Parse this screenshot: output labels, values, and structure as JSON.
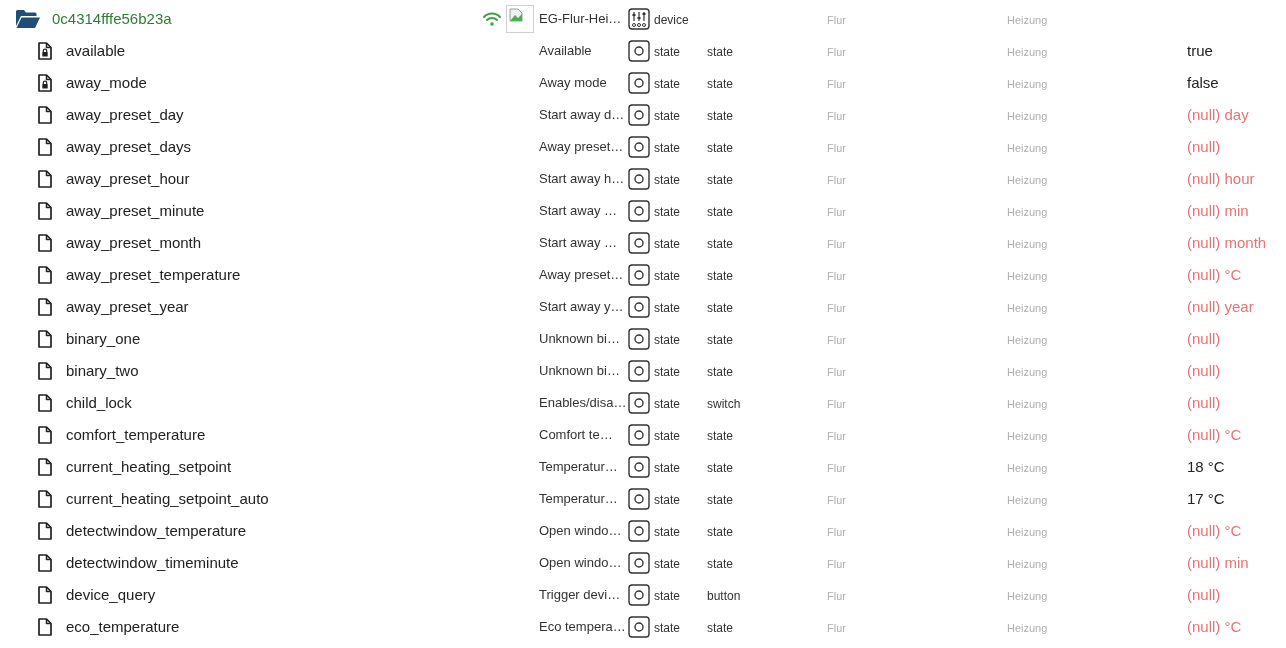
{
  "device": {
    "id": "0c4314fffe56b23a",
    "expanded": true,
    "online": true,
    "name": "EG-Flur-Hei…",
    "type": "device",
    "room": "Flur",
    "function": "Heizung"
  },
  "states": [
    {
      "id": "available",
      "locked": true,
      "name": "Available",
      "type": "state",
      "role": "state",
      "room": "Flur",
      "function": "Heizung",
      "value": "true",
      "is_null": false
    },
    {
      "id": "away_mode",
      "locked": true,
      "name": "Away mode",
      "type": "state",
      "role": "state",
      "room": "Flur",
      "function": "Heizung",
      "value": "false",
      "is_null": false
    },
    {
      "id": "away_preset_day",
      "locked": false,
      "name": "Start away d…",
      "type": "state",
      "role": "state",
      "room": "Flur",
      "function": "Heizung",
      "value": "(null) day",
      "is_null": true
    },
    {
      "id": "away_preset_days",
      "locked": false,
      "name": "Away preset…",
      "type": "state",
      "role": "state",
      "room": "Flur",
      "function": "Heizung",
      "value": "(null)",
      "is_null": true
    },
    {
      "id": "away_preset_hour",
      "locked": false,
      "name": "Start away h…",
      "type": "state",
      "role": "state",
      "room": "Flur",
      "function": "Heizung",
      "value": "(null) hour",
      "is_null": true
    },
    {
      "id": "away_preset_minute",
      "locked": false,
      "name": "Start away …",
      "type": "state",
      "role": "state",
      "room": "Flur",
      "function": "Heizung",
      "value": "(null) min",
      "is_null": true
    },
    {
      "id": "away_preset_month",
      "locked": false,
      "name": "Start away …",
      "type": "state",
      "role": "state",
      "room": "Flur",
      "function": "Heizung",
      "value": "(null) month",
      "is_null": true
    },
    {
      "id": "away_preset_temperature",
      "locked": false,
      "name": "Away preset…",
      "type": "state",
      "role": "state",
      "room": "Flur",
      "function": "Heizung",
      "value": "(null) °C",
      "is_null": true
    },
    {
      "id": "away_preset_year",
      "locked": false,
      "name": "Start away y…",
      "type": "state",
      "role": "state",
      "room": "Flur",
      "function": "Heizung",
      "value": "(null) year",
      "is_null": true
    },
    {
      "id": "binary_one",
      "locked": false,
      "name": "Unknown bi…",
      "type": "state",
      "role": "state",
      "room": "Flur",
      "function": "Heizung",
      "value": "(null)",
      "is_null": true
    },
    {
      "id": "binary_two",
      "locked": false,
      "name": "Unknown bi…",
      "type": "state",
      "role": "state",
      "room": "Flur",
      "function": "Heizung",
      "value": "(null)",
      "is_null": true
    },
    {
      "id": "child_lock",
      "locked": false,
      "name": "Enables/disa…",
      "type": "state",
      "role": "switch",
      "room": "Flur",
      "function": "Heizung",
      "value": "(null)",
      "is_null": true
    },
    {
      "id": "comfort_temperature",
      "locked": false,
      "name": "Comfort te…",
      "type": "state",
      "role": "state",
      "room": "Flur",
      "function": "Heizung",
      "value": "(null) °C",
      "is_null": true
    },
    {
      "id": "current_heating_setpoint",
      "locked": false,
      "name": "Temperatur…",
      "type": "state",
      "role": "state",
      "room": "Flur",
      "function": "Heizung",
      "value": "18 °C",
      "is_null": false
    },
    {
      "id": "current_heating_setpoint_auto",
      "locked": false,
      "name": "Temperatur…",
      "type": "state",
      "role": "state",
      "room": "Flur",
      "function": "Heizung",
      "value": "17 °C",
      "is_null": false
    },
    {
      "id": "detectwindow_temperature",
      "locked": false,
      "name": "Open windo…",
      "type": "state",
      "role": "state",
      "room": "Flur",
      "function": "Heizung",
      "value": "(null) °C",
      "is_null": true
    },
    {
      "id": "detectwindow_timeminute",
      "locked": false,
      "name": "Open windo…",
      "type": "state",
      "role": "state",
      "room": "Flur",
      "function": "Heizung",
      "value": "(null) min",
      "is_null": true
    },
    {
      "id": "device_query",
      "locked": false,
      "name": "Trigger devi…",
      "type": "state",
      "role": "button",
      "room": "Flur",
      "function": "Heizung",
      "value": "(null)",
      "is_null": true
    },
    {
      "id": "eco_temperature",
      "locked": false,
      "name": "Eco tempera…",
      "type": "state",
      "role": "state",
      "room": "Flur",
      "function": "Heizung",
      "value": "(null) °C",
      "is_null": true
    }
  ]
}
